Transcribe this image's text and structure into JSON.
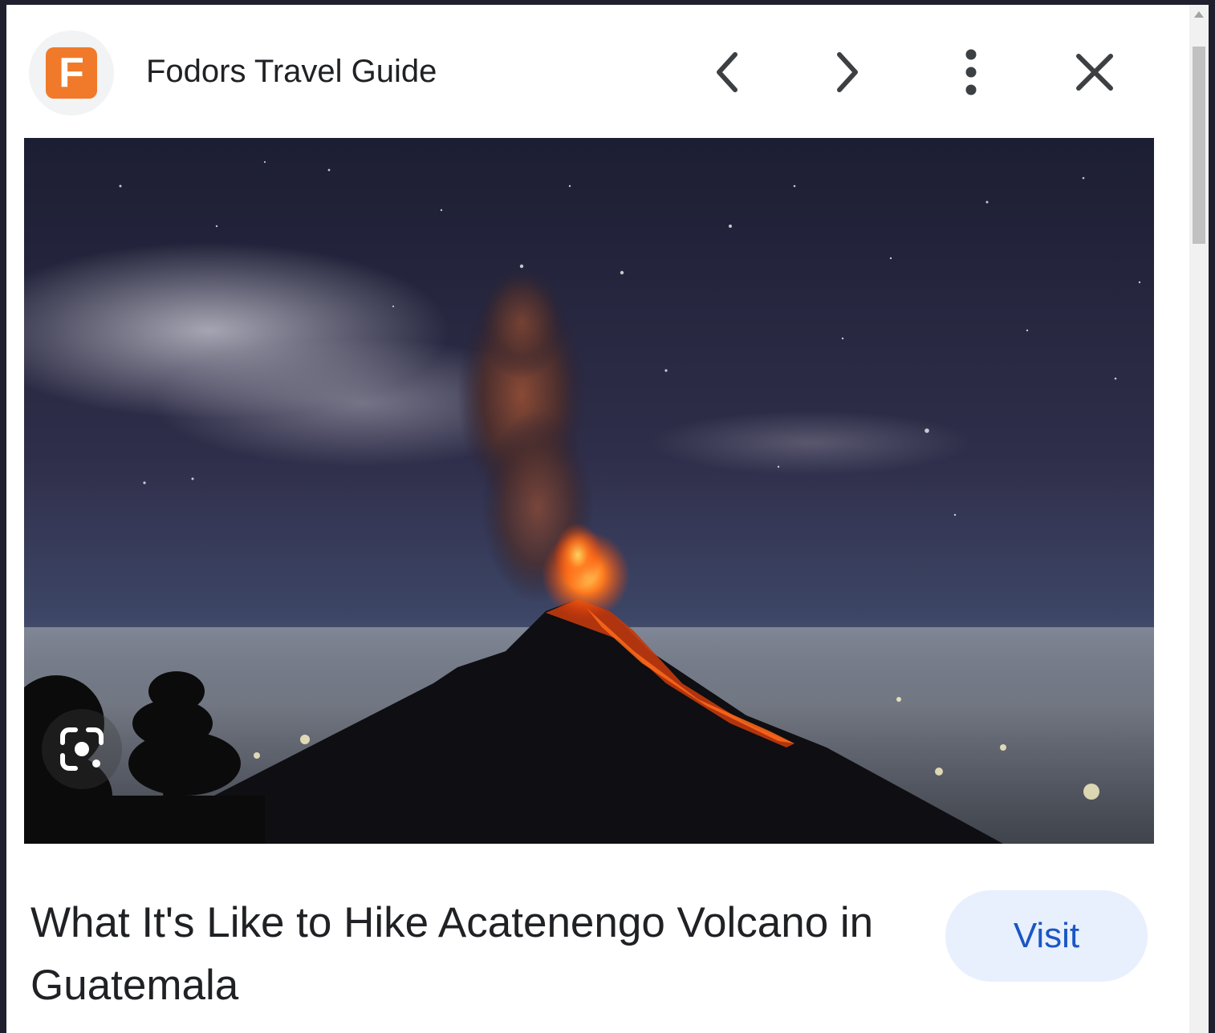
{
  "header": {
    "favicon_letter": "F",
    "site_name": "Fodors Travel Guide",
    "brand_color": "#f07a2a",
    "icons": [
      "chevron-left-icon",
      "chevron-right-icon",
      "more-vert-icon",
      "close-icon"
    ]
  },
  "image": {
    "subject": "erupting-volcano-night-photo",
    "lens_icon": "google-lens-icon"
  },
  "footer": {
    "title": "What It's Like to Hike Acatenengo Volcano in Guatemala",
    "visit_label": "Visit"
  },
  "colors": {
    "visit_bg": "#e8f0fe",
    "visit_text": "#1a56c4",
    "text": "#202124"
  }
}
